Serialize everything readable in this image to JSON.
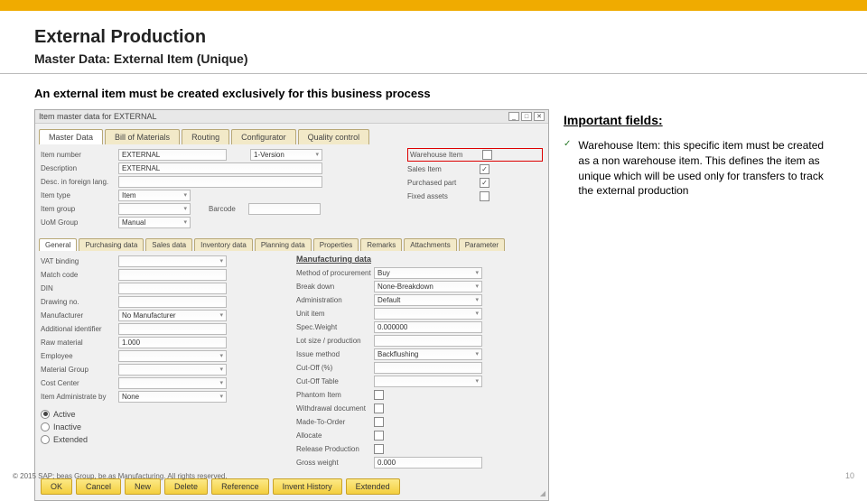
{
  "header": {
    "title": "External Production",
    "subtitle": "Master Data: External Item (Unique)"
  },
  "intro": "An external item must be created exclusively for this business process",
  "window": {
    "title": "Item master data for EXTERNAL",
    "controls": {
      "min": "_",
      "max": "□",
      "close": "✕"
    },
    "tabs": [
      "Master Data",
      "Bill of Materials",
      "Routing",
      "Configurator",
      "Quality control"
    ],
    "active_tab": 0,
    "left_fields": {
      "item_number": {
        "label": "Item number",
        "value": "EXTERNAL",
        "version_label": "1-Version"
      },
      "description": {
        "label": "Description",
        "value": "EXTERNAL"
      },
      "desc_foreign": {
        "label": "Desc. in foreign lang."
      },
      "item_type": {
        "label": "Item type",
        "value": "Item"
      },
      "item_group": {
        "label": "Item group",
        "value": ""
      },
      "uom_group": {
        "label": "UoM Group",
        "value": "Manual"
      },
      "barcode_label": "Barcode"
    },
    "right_fields": {
      "warehouse_item": {
        "label": "Warehouse Item",
        "checked": false
      },
      "sales_item": {
        "label": "Sales Item",
        "checked": true
      },
      "purchased_part": {
        "label": "Purchased part",
        "checked": true
      },
      "fixed_assets": {
        "label": "Fixed assets",
        "checked": false
      }
    },
    "subtabs": [
      "General",
      "Purchasing data",
      "Sales data",
      "Inventory data",
      "Planning data",
      "Properties",
      "Remarks",
      "Attachments",
      "Parameter"
    ],
    "active_subtab": 0,
    "general_left": {
      "vat_binding": "VAT binding",
      "match_code": "Match code",
      "din": "DIN",
      "drawing_no": "Drawing no.",
      "manufacturer": {
        "label": "Manufacturer",
        "value": "No Manufacturer"
      },
      "add_id": "Additional identifier",
      "raw_material": {
        "label": "Raw material",
        "value": "1.000"
      },
      "employee": "Employee",
      "material_group": "Material Group",
      "cost_center": "Cost Center",
      "item_admin": {
        "label": "Item Administrate by",
        "value": "None"
      }
    },
    "manufacturing": {
      "title": "Manufacturing data",
      "procurement": {
        "label": "Method of procurement",
        "value": "Buy"
      },
      "breakdown": {
        "label": "Break down",
        "value": "None-Breakdown"
      },
      "admin": {
        "label": "Administration",
        "value": "Default"
      },
      "unit_item": "Unit item",
      "spec_weight": {
        "label": "Spec.Weight",
        "value": "0.000000"
      },
      "lot_size": "Lot size / production",
      "issue_method": {
        "label": "Issue method",
        "value": "Backflushing"
      },
      "cutoff_pct": "Cut-Off (%)",
      "cutoff_table": "Cut-Off Table",
      "phantom": {
        "label": "Phantom Item",
        "checked": false
      },
      "withdrawal": {
        "label": "Withdrawal document",
        "checked": false
      },
      "mto": {
        "label": "Made-To-Order",
        "checked": false
      },
      "allocate": {
        "label": "Allocate",
        "checked": false
      },
      "release": {
        "label": "Release Production",
        "checked": false
      },
      "gross_weight": {
        "label": "Gross weight",
        "value": "0.000"
      }
    },
    "status_radios": {
      "active": {
        "label": "Active",
        "checked": true
      },
      "inactive": {
        "label": "Inactive",
        "checked": false
      },
      "extended": {
        "label": "Extended",
        "checked": false
      }
    },
    "buttons": [
      "OK",
      "Cancel",
      "New",
      "Delete",
      "Reference",
      "Invent History",
      "Extended"
    ]
  },
  "right_panel": {
    "heading": "Important fields:",
    "bullet_text": "Warehouse Item: this specific item must be created as a non warehouse item. This defines the item as unique which will be used only for transfers to track the external production"
  },
  "footer": {
    "copyright": "© 2015 SAP; beas Group, be.as Manufacturing. All rights reserved.",
    "page": "10"
  }
}
